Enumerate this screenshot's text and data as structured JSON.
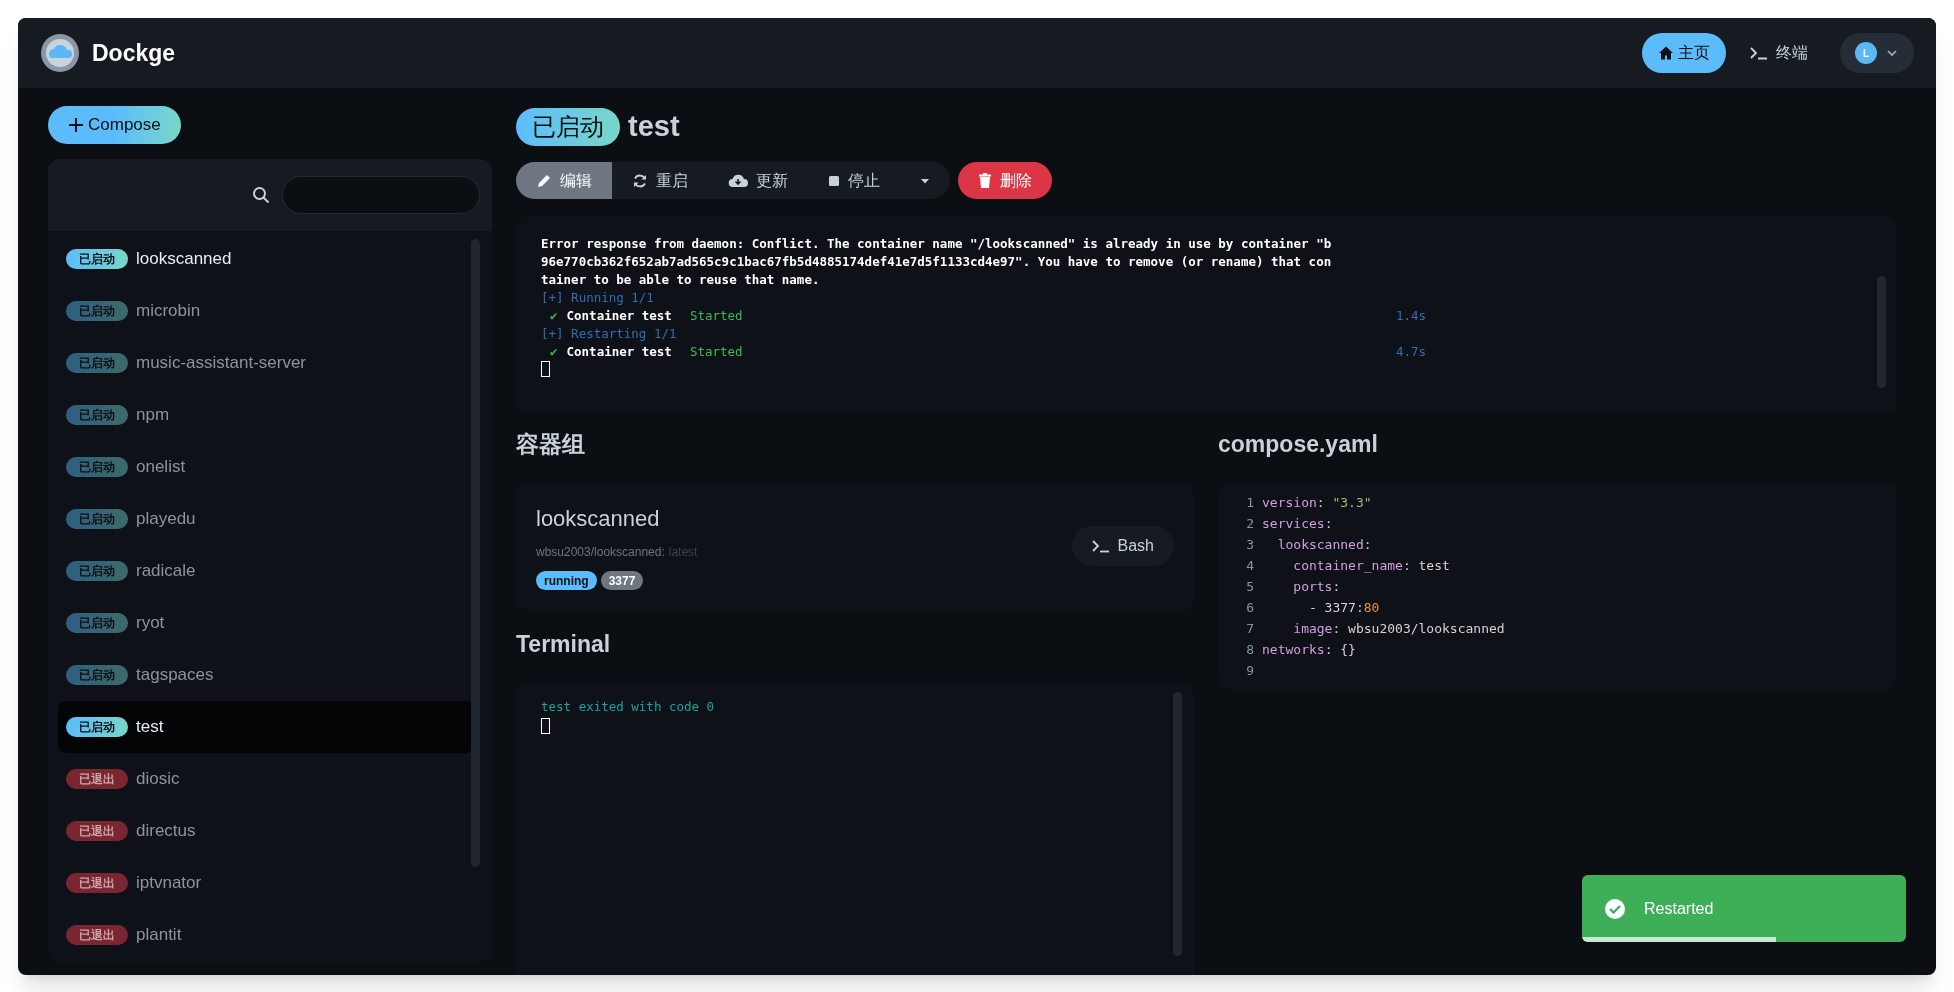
{
  "header": {
    "app_name": "Dockge",
    "nav": [
      {
        "label": "主页",
        "kind": "home",
        "selected": true
      },
      {
        "label": "终端",
        "kind": "terminal",
        "selected": false
      }
    ],
    "avatar": "L"
  },
  "sidebar": {
    "compose_button": "Compose",
    "stacks": [
      {
        "kind": "active",
        "status_label": "已启动",
        "name": "lookscanned",
        "highlighted": true,
        "selected": false
      },
      {
        "kind": "active",
        "status_label": "已启动",
        "name": "microbin",
        "highlighted": false,
        "selected": false
      },
      {
        "kind": "active",
        "status_label": "已启动",
        "name": "music-assistant-server",
        "highlighted": false,
        "selected": false
      },
      {
        "kind": "active",
        "status_label": "已启动",
        "name": "npm",
        "highlighted": false,
        "selected": false
      },
      {
        "kind": "active",
        "status_label": "已启动",
        "name": "onelist",
        "highlighted": false,
        "selected": false
      },
      {
        "kind": "active",
        "status_label": "已启动",
        "name": "playedu",
        "highlighted": false,
        "selected": false
      },
      {
        "kind": "active",
        "status_label": "已启动",
        "name": "radicale",
        "highlighted": false,
        "selected": false
      },
      {
        "kind": "active",
        "status_label": "已启动",
        "name": "ryot",
        "highlighted": false,
        "selected": false
      },
      {
        "kind": "active",
        "status_label": "已启动",
        "name": "tagspaces",
        "highlighted": false,
        "selected": false
      },
      {
        "kind": "active",
        "status_label": "已启动",
        "name": "test",
        "highlighted": true,
        "selected": true
      },
      {
        "kind": "exited",
        "status_label": "已退出",
        "name": "diosic",
        "highlighted": false,
        "selected": false
      },
      {
        "kind": "exited",
        "status_label": "已退出",
        "name": "directus",
        "highlighted": false,
        "selected": false
      },
      {
        "kind": "exited",
        "status_label": "已退出",
        "name": "iptvnator",
        "highlighted": false,
        "selected": false
      },
      {
        "kind": "exited",
        "status_label": "已退出",
        "name": "plantit",
        "highlighted": false,
        "selected": false
      }
    ]
  },
  "stack": {
    "status_label": "已启动",
    "kind": "active",
    "name": "test",
    "actions": [
      {
        "kind": "edit",
        "label": "编辑",
        "selected": true
      },
      {
        "kind": "restart",
        "label": "重启",
        "selected": false
      },
      {
        "kind": "update",
        "label": "更新",
        "selected": false
      },
      {
        "kind": "stop",
        "label": "停止",
        "selected": false
      },
      {
        "kind": "more",
        "selected": false
      }
    ],
    "delete_button": "删除",
    "log": [
      {
        "kind": "plain",
        "text": "Error response from daemon: Conflict. The container name \"/lookscanned\" is already in use by container \"b"
      },
      {
        "kind": "plain",
        "text": "96e770cb362f652ab7ad565c9c1bac67fb5d4885174def41e7d5f1133cd4e97\". You have to remove (or rename) that con"
      },
      {
        "kind": "plain",
        "text": "tainer to be able to reuse that name."
      },
      {
        "kind": "step",
        "text": "[+] Running 1/1"
      },
      {
        "kind": "result",
        "mark": "✔",
        "text": "Container test",
        "state": "Started",
        "time": "1.4s"
      },
      {
        "kind": "step",
        "text": "[+] Restarting 1/1"
      },
      {
        "kind": "result",
        "mark": "✔",
        "text": "Container test",
        "state": "Started",
        "time": "4.7s"
      },
      {
        "kind": "cursor"
      }
    ]
  },
  "containers": {
    "title": "容器组",
    "items": [
      {
        "name": "lookscanned",
        "image": "wbsu2003/lookscanned:",
        "tag": "latest",
        "state": "running",
        "port": "3377",
        "shell_button": "Bash"
      }
    ]
  },
  "terminal": {
    "title": "Terminal",
    "lines": [
      {
        "kind": "exit",
        "text": "test exited with code 0"
      },
      {
        "kind": "cursor"
      }
    ]
  },
  "compose": {
    "title": "compose.yaml",
    "lines": [
      {
        "number": "1",
        "tokens": [
          {
            "kind": "key",
            "text": "version"
          },
          {
            "kind": "plain",
            "text": ": "
          },
          {
            "kind": "string",
            "text": "\"3.3\""
          }
        ]
      },
      {
        "number": "2",
        "tokens": [
          {
            "kind": "key",
            "text": "services"
          },
          {
            "kind": "plain",
            "text": ":"
          }
        ]
      },
      {
        "number": "3",
        "tokens": [
          {
            "kind": "key",
            "text": "  lookscanned"
          },
          {
            "kind": "plain",
            "text": ":"
          }
        ]
      },
      {
        "number": "4",
        "tokens": [
          {
            "kind": "key",
            "text": "    container_name"
          },
          {
            "kind": "plain",
            "text": ": test"
          }
        ]
      },
      {
        "number": "5",
        "tokens": [
          {
            "kind": "key",
            "text": "    ports"
          },
          {
            "kind": "plain",
            "text": ":"
          }
        ]
      },
      {
        "number": "6",
        "tokens": [
          {
            "kind": "plain",
            "text": "      - 3377:"
          },
          {
            "kind": "number",
            "text": "80"
          }
        ]
      },
      {
        "number": "7",
        "tokens": [
          {
            "kind": "key",
            "text": "    image"
          },
          {
            "kind": "plain",
            "text": ": wbsu2003/lookscanned"
          }
        ]
      },
      {
        "number": "8",
        "tokens": [
          {
            "kind": "key",
            "text": "networks"
          },
          {
            "kind": "plain",
            "text": ": {}"
          }
        ]
      },
      {
        "number": "9"
      }
    ]
  },
  "toast": {
    "kind": "success",
    "message": "Restarted",
    "level": 0.6
  }
}
